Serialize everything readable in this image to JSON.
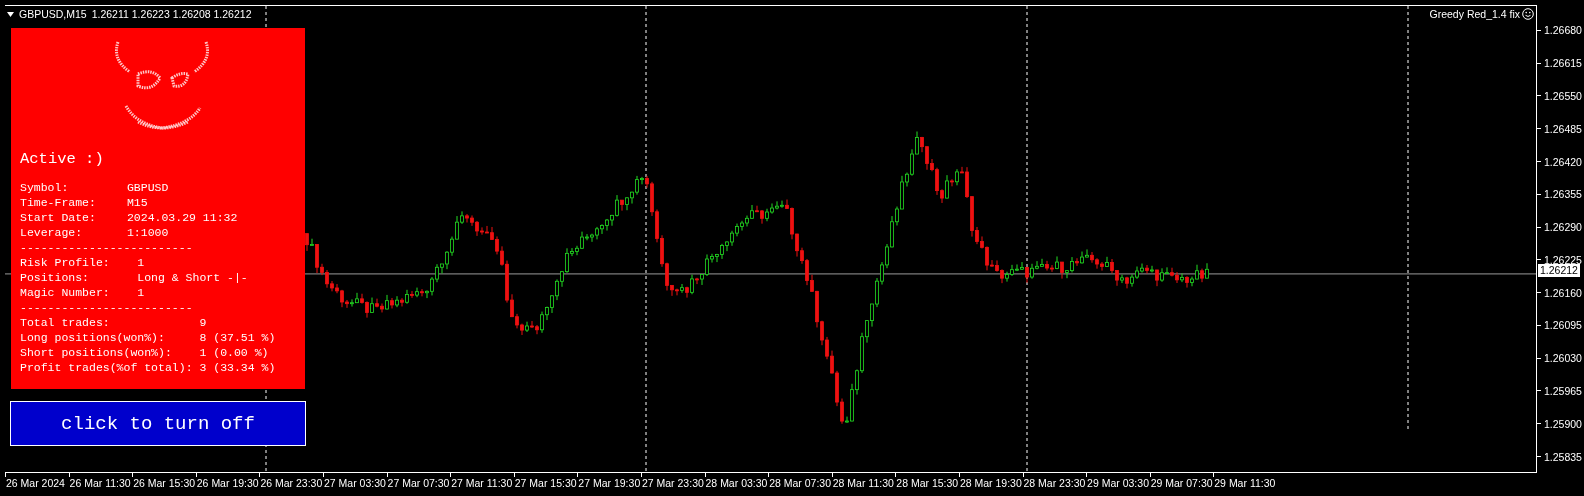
{
  "header": {
    "symbol": "GBPUSD,M15",
    "quotes": "1.26211 1.26223 1.26208 1.26212"
  },
  "expert": {
    "name": "Greedy Red_1.4 fix"
  },
  "panel": {
    "status": "Active :)",
    "groups": [
      {
        "rows": [
          {
            "label": "Symbol:",
            "value": "GBPUSD"
          },
          {
            "label": "Time-Frame:",
            "value": "M15"
          },
          {
            "label": "Start Date:",
            "value": "2024.03.29 11:32"
          },
          {
            "label": "Leverage:",
            "value": "1:1000"
          }
        ]
      },
      {
        "separator": "-------------------------",
        "rows": [
          {
            "label": "Risk Profile:",
            "value": "1"
          },
          {
            "label": "Positions:",
            "value": "Long & Short -|-"
          },
          {
            "label": "Magic Number:",
            "value": "1"
          }
        ]
      },
      {
        "separator": "-------------------------",
        "rows": [
          {
            "label": "Total trades:",
            "value": "9"
          },
          {
            "label": "Long positions(won%):",
            "value": "8 (37.51 %)"
          },
          {
            "label": "Short positions(won%):",
            "value": "1 (0.00 %)"
          },
          {
            "label": "Profit trades(%of total):",
            "value": "3 (33.34 %)"
          }
        ]
      }
    ]
  },
  "button": {
    "label": "click to turn off"
  },
  "price_axis": {
    "labels": [
      "1.26680",
      "1.26615",
      "1.26550",
      "1.26485",
      "1.26420",
      "1.26355",
      "1.26290",
      "1.26225",
      "1.26160",
      "1.26095",
      "1.26030",
      "1.25965",
      "1.25900",
      "1.25835"
    ],
    "bid": "1.26212"
  },
  "time_axis": {
    "labels": [
      "26 Mar 2024",
      "26 Mar 11:30",
      "26 Mar 15:30",
      "26 Mar 19:30",
      "26 Mar 23:30",
      "27 Mar 03:30",
      "27 Mar 07:30",
      "27 Mar 11:30",
      "27 Mar 15:30",
      "27 Mar 19:30",
      "27 Mar 23:30",
      "28 Mar 03:30",
      "28 Mar 07:30",
      "28 Mar 11:30",
      "28 Mar 15:30",
      "28 Mar 19:30",
      "28 Mar 23:30",
      "29 Mar 03:30",
      "29 Mar 07:30",
      "29 Mar 11:30"
    ]
  }
}
